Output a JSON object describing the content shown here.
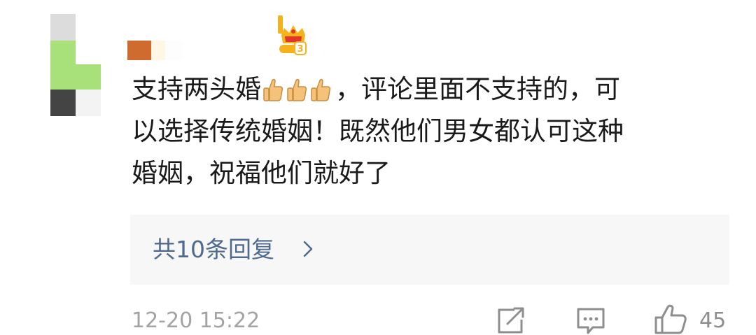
{
  "comment": {
    "text_line1_before": "支持两头婚",
    "thumbs_icon": "thumbs-up-emoji",
    "text_line1_after": "，评论里面不支持的，可",
    "text_line2": "以选择传统婚姻！既然他们男女都认可这种",
    "text_line3": "婚姻，祝福他们就好了"
  },
  "badge": {
    "icon": "crown-level-badge",
    "level": "3"
  },
  "replies": {
    "label": "共10条回复",
    "chevron_icon": "chevron-right-icon"
  },
  "footer": {
    "timestamp": "12-20 15:22",
    "share_icon": "share-icon",
    "reply_icon": "comment-icon",
    "like_icon": "thumbs-up-icon",
    "like_count": "45"
  },
  "colors": {
    "text": "#1a1a1a",
    "link": "#4e6a8f",
    "muted": "#a3a3a3",
    "replies_bg": "#f7f7f7",
    "badge_orange": "#f5b21b",
    "badge_red": "#e0362b"
  }
}
